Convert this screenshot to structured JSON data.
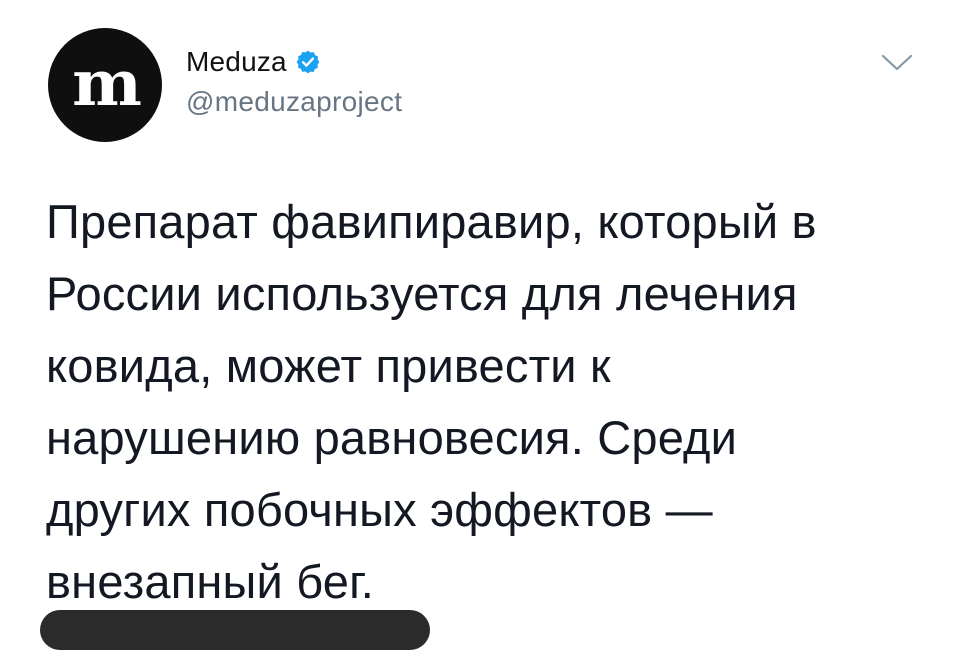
{
  "account": {
    "avatar_letter": "m",
    "display_name": "Meduza",
    "handle": "@meduzaproject",
    "verified": true
  },
  "icons": {
    "verified": "verified-badge-icon",
    "menu": "chevron-down-icon"
  },
  "colors": {
    "verified_blue": "#1da1f2",
    "handle_gray": "#687684",
    "text": "#141823",
    "avatar_bg": "#0f0f0f",
    "redaction": "#2b2b2b"
  },
  "tweet": {
    "lines": [
      "Препарат фавипиравир, который в",
      "России используется для лечения",
      "ковида, может привести к",
      "нарушению равновесия. Среди",
      "других побочных эффектов —",
      "внезапный бег."
    ]
  }
}
